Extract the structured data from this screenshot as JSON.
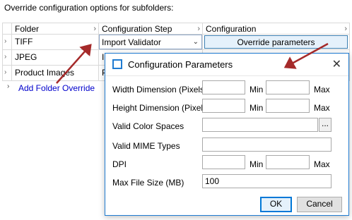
{
  "heading": "Override configuration options for subfolders:",
  "grid": {
    "columns": [
      "Folder",
      "Configuration Step",
      "Configuration"
    ],
    "rows": [
      {
        "folder": "TIFF",
        "step": "Import Validator",
        "config": "Override parameters"
      },
      {
        "folder": "JPEG",
        "step": "Im",
        "config": ""
      },
      {
        "folder": "Product Images",
        "step": "Pr",
        "config": ""
      }
    ],
    "add_label": "Add Folder Override"
  },
  "dialog": {
    "title": "Configuration Parameters",
    "labels": {
      "width": "Width Dimension (Pixels)",
      "height": "Height Dimension (Pixels)",
      "color_spaces": "Valid Color Spaces",
      "mime": "Valid MIME Types",
      "dpi": "DPI",
      "max_size": "Max File Size (MB)",
      "min": "Min",
      "max": "Max"
    },
    "values": {
      "max_size": "100"
    },
    "browse": "...",
    "ok": "OK",
    "cancel": "Cancel"
  },
  "colors": {
    "accent": "#1f7bd1",
    "arrow": "#a52a2a"
  }
}
